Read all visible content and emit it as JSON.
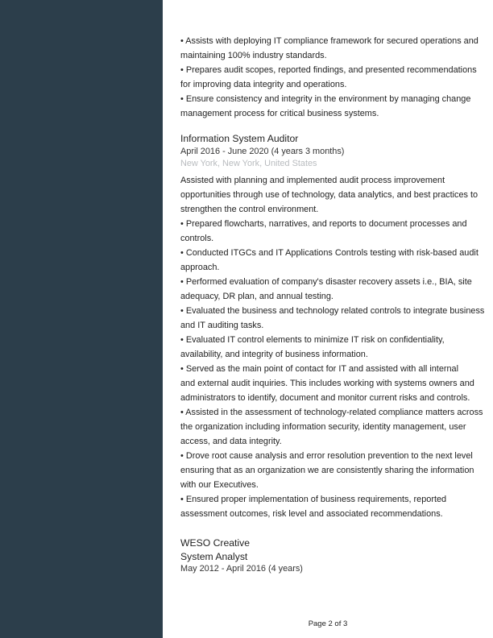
{
  "top_bullets": [
    "• Assists with deploying IT compliance framework for secured operations and",
    "maintaining 100% industry standards.",
    "• Prepares audit scopes, reported findings, and presented recommendations",
    "for improving data integrity and operations.",
    "• Ensure consistency and integrity in the environment by managing change",
    "management process for critical business systems."
  ],
  "job2": {
    "title": "Information System Auditor",
    "dates": "April 2016 - June 2020 (4 years 3 months)",
    "location": "New York, New York, United States",
    "lines": [
      "Assisted with planning and implemented audit process improvement",
      "opportunities through use of technology, data analytics, and best practices to",
      "strengthen the control environment.",
      "• Prepared flowcharts, narratives, and reports to document processes and",
      "controls.",
      "• Conducted ITGCs and IT Applications Controls testing with risk-based audit",
      "approach.",
      "• Performed evaluation of company's disaster recovery assets i.e., BIA, site",
      "adequacy, DR plan, and annual testing.",
      "• Evaluated the business and technology related controls to integrate business",
      "and IT auditing tasks.",
      "• Evaluated IT control elements to minimize IT risk on confidentiality,",
      "availability, and integrity of business information.",
      "• Served as the main point of contact for IT and assisted with all internal",
      "and external audit inquiries. This includes working with systems owners and",
      "administrators to identify, document and monitor current risks and controls.",
      "• Assisted in the assessment of technology-related compliance matters across",
      "the organization including information security, identity management, user",
      "access, and data integrity.",
      "• Drove root cause analysis and error resolution prevention to the next level",
      "ensuring that as an organization we are consistently sharing the information",
      "with our Executives.",
      "• Ensured proper implementation of business requirements, reported",
      "assessment outcomes, risk level and associated recommendations."
    ]
  },
  "company3": {
    "name": "WESO Creative",
    "title": "System Analyst",
    "dates": "May 2012 - April 2016 (4 years)"
  },
  "footer": {
    "page": "Page 2 of 3"
  }
}
